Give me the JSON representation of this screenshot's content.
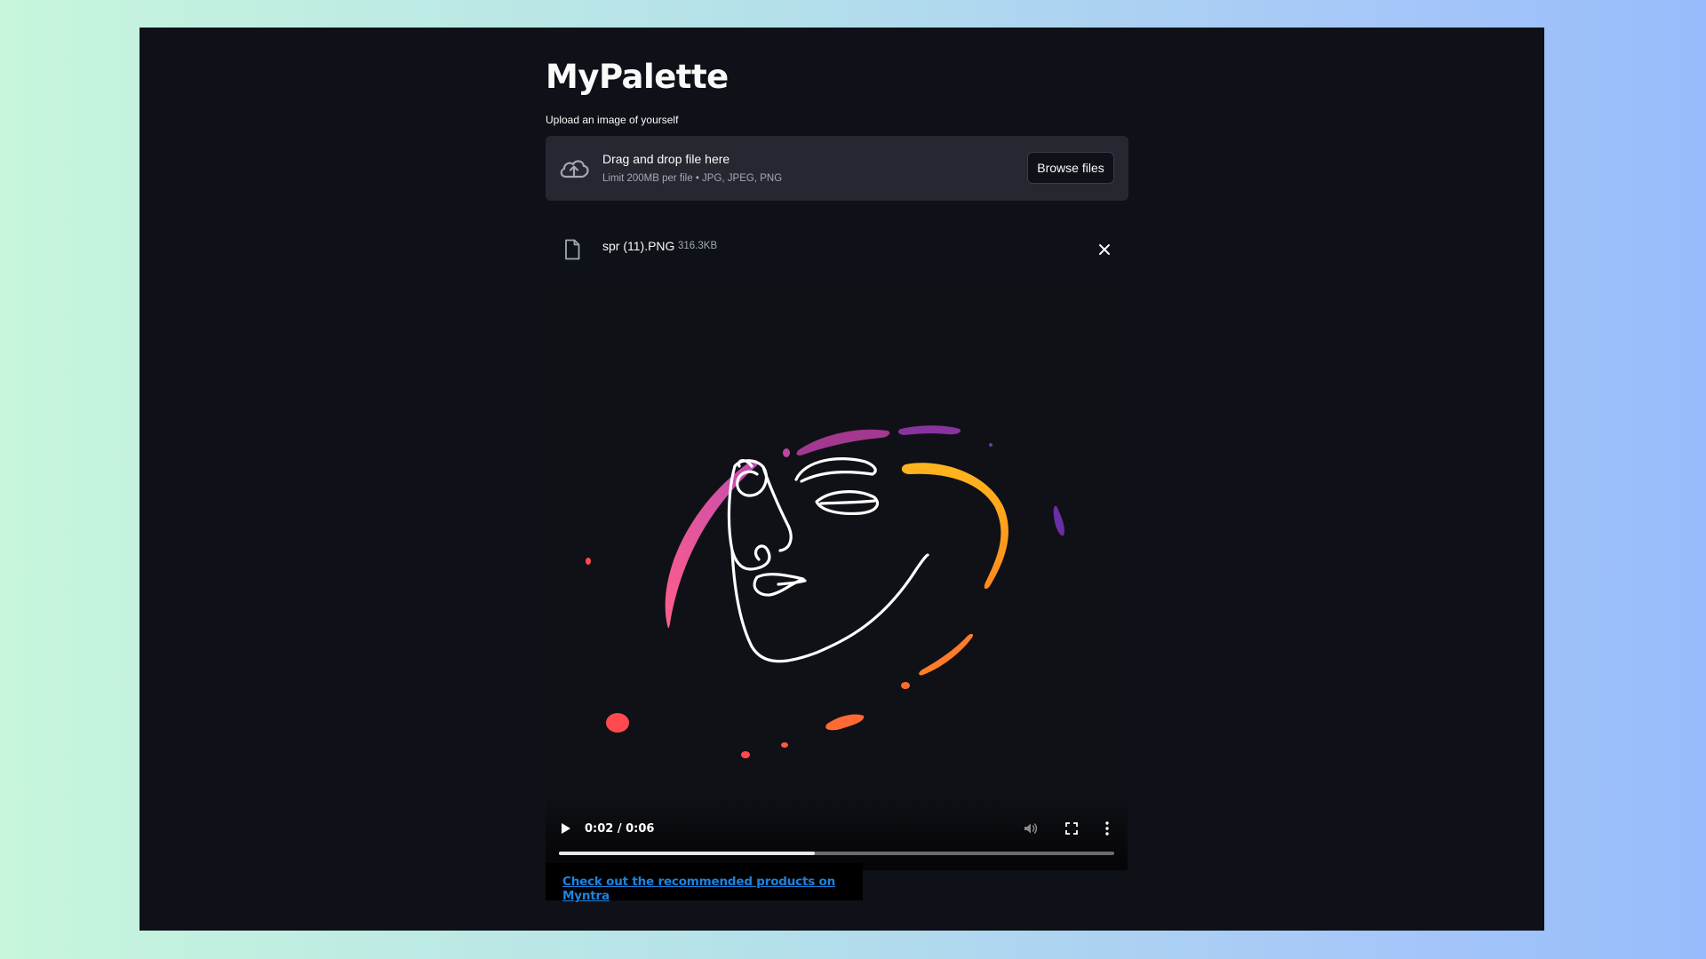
{
  "app": {
    "title": "MyPalette",
    "background_color": "#0e1117"
  },
  "uploader": {
    "label": "Upload an image of yourself",
    "drop_title": "Drag and drop file here",
    "drop_subtitle": "Limit 200MB per file • JPG, JPEG, PNG",
    "browse_label": "Browse files",
    "icon": "cloud-upload-icon"
  },
  "uploaded_file": {
    "name": "spr (11).PNG",
    "size": "316.3KB",
    "icon": "file-icon",
    "remove_icon": "close-icon"
  },
  "video_player": {
    "time": "0:02 / 0:06",
    "progress_fraction": 0.46,
    "icons": [
      "play-icon",
      "volume-icon",
      "fullscreen-icon",
      "more-options-icon"
    ]
  },
  "link": {
    "text": "Check out the recommended products on Myntra",
    "color": "#1c83e1"
  }
}
